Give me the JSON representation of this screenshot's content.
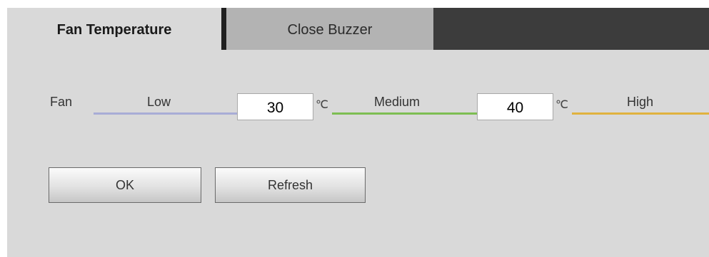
{
  "tabs": [
    {
      "label": "Fan Temperature",
      "active": true
    },
    {
      "label": "Close Buzzer",
      "active": false
    }
  ],
  "fan": {
    "row_label": "Fan",
    "low_label": "Low",
    "medium_label": "Medium",
    "high_label": "High",
    "low_threshold": "30",
    "high_threshold": "40",
    "unit": "℃",
    "colors": {
      "low": "#a8acd6",
      "medium": "#7dbe52",
      "high": "#e0b23e"
    }
  },
  "buttons": {
    "ok_label": "OK",
    "refresh_label": "Refresh"
  }
}
